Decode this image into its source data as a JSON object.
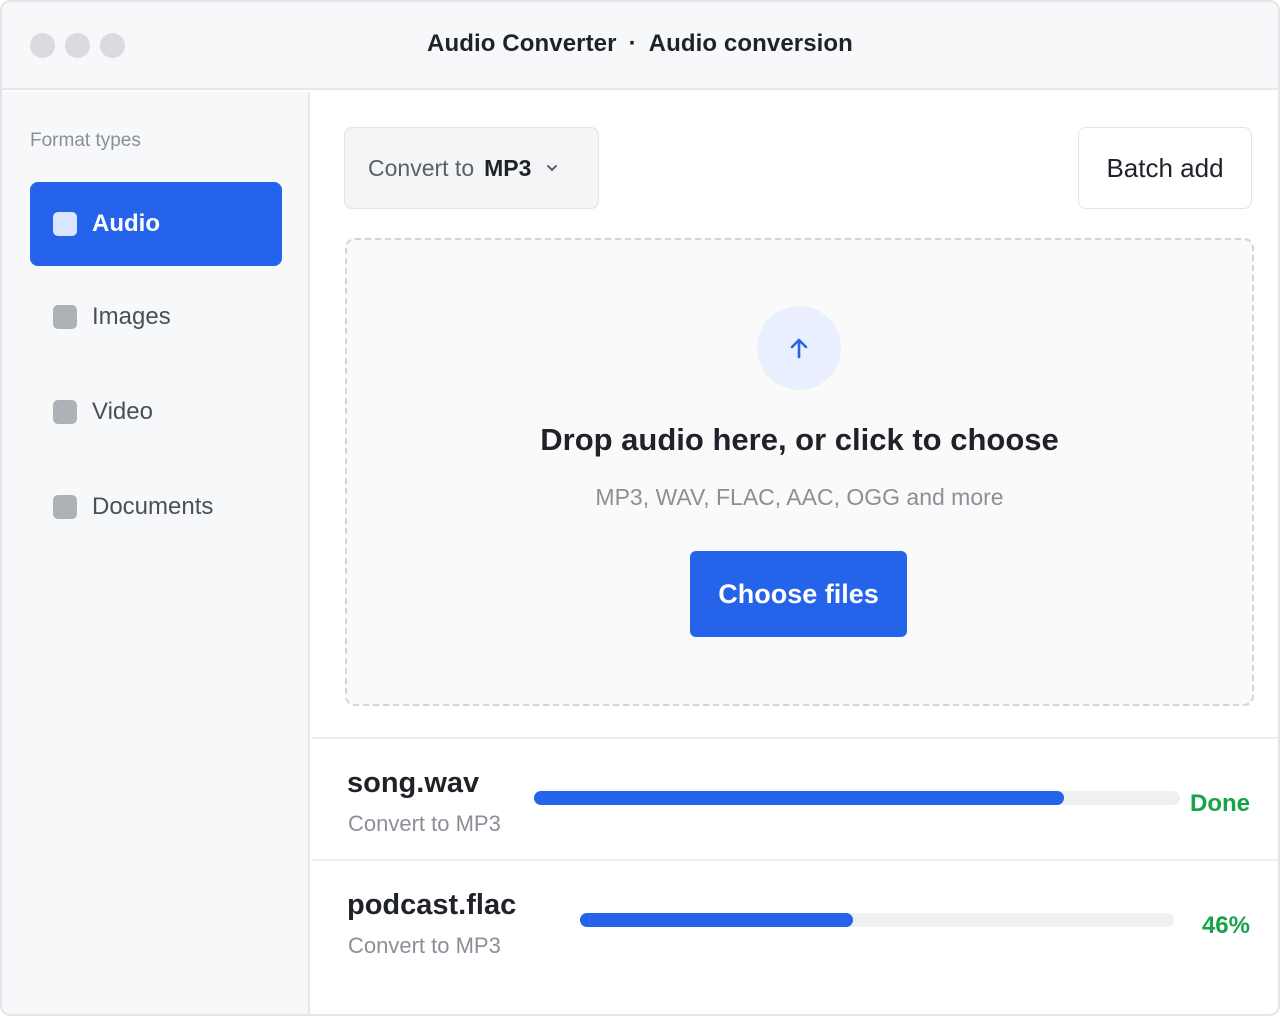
{
  "window": {
    "app_name": "Audio Converter",
    "separator": "·",
    "section": "Audio conversion"
  },
  "sidebar": {
    "heading": "Format types",
    "items": [
      {
        "label": "Audio",
        "active": true
      },
      {
        "label": "Images",
        "active": false
      },
      {
        "label": "Video",
        "active": false
      },
      {
        "label": "Documents",
        "active": false
      }
    ]
  },
  "toolbar": {
    "convert_prefix": "Convert to",
    "convert_value": "MP3",
    "batch_label": "Batch add"
  },
  "dropzone": {
    "icon": "arrow-up-icon",
    "title": "Drop audio here, or click to choose",
    "subtitle": "MP3, WAV, FLAC, AAC, OGG and more",
    "button_label": "Choose files"
  },
  "files": [
    {
      "name": "song.wav",
      "sub": "Convert to MP3",
      "progress": 0.82,
      "status": "Done"
    },
    {
      "name": "podcast.flac",
      "sub": "Convert to MP3",
      "progress": 0.46,
      "status": "46%"
    }
  ],
  "colors": {
    "accent": "#2563eb",
    "success": "#16a34a"
  }
}
